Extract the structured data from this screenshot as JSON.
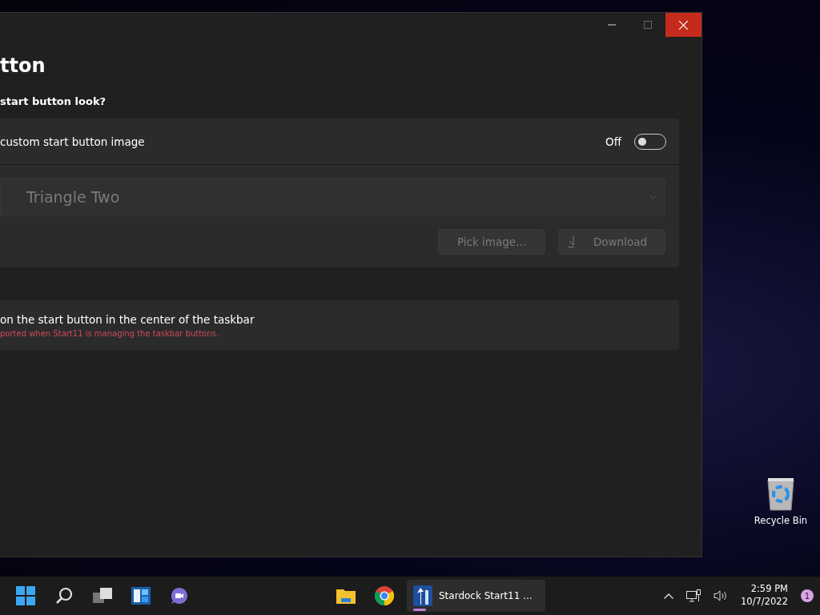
{
  "window": {
    "heading": "tton",
    "question": "start button look?"
  },
  "custom_image": {
    "label": "custom start button image",
    "state_text": "Off",
    "on": false
  },
  "image_dropdown": {
    "value": "Triangle Two",
    "disabled": true
  },
  "buttons": [
    {
      "label": "Pick image...",
      "disabled": true
    },
    {
      "label": "Download",
      "disabled": true
    }
  ],
  "center_option": {
    "label": "on the start button in the center of the taskbar",
    "note": "ported when Start11 is managing the taskbar buttons."
  },
  "desktop_icons": [
    {
      "label": "Recycle Bin"
    }
  ],
  "taskbar": {
    "items": [
      {
        "running": false
      },
      {
        "running": false
      },
      {
        "running": false
      },
      {
        "running": false
      },
      {
        "running": false
      },
      {
        "running": false
      },
      {
        "running": false
      },
      {
        "label": "Stardock Start11 ...",
        "running": true
      }
    ],
    "time": "2:59 PM",
    "date": "10/7/2022",
    "notification_count": "1"
  }
}
